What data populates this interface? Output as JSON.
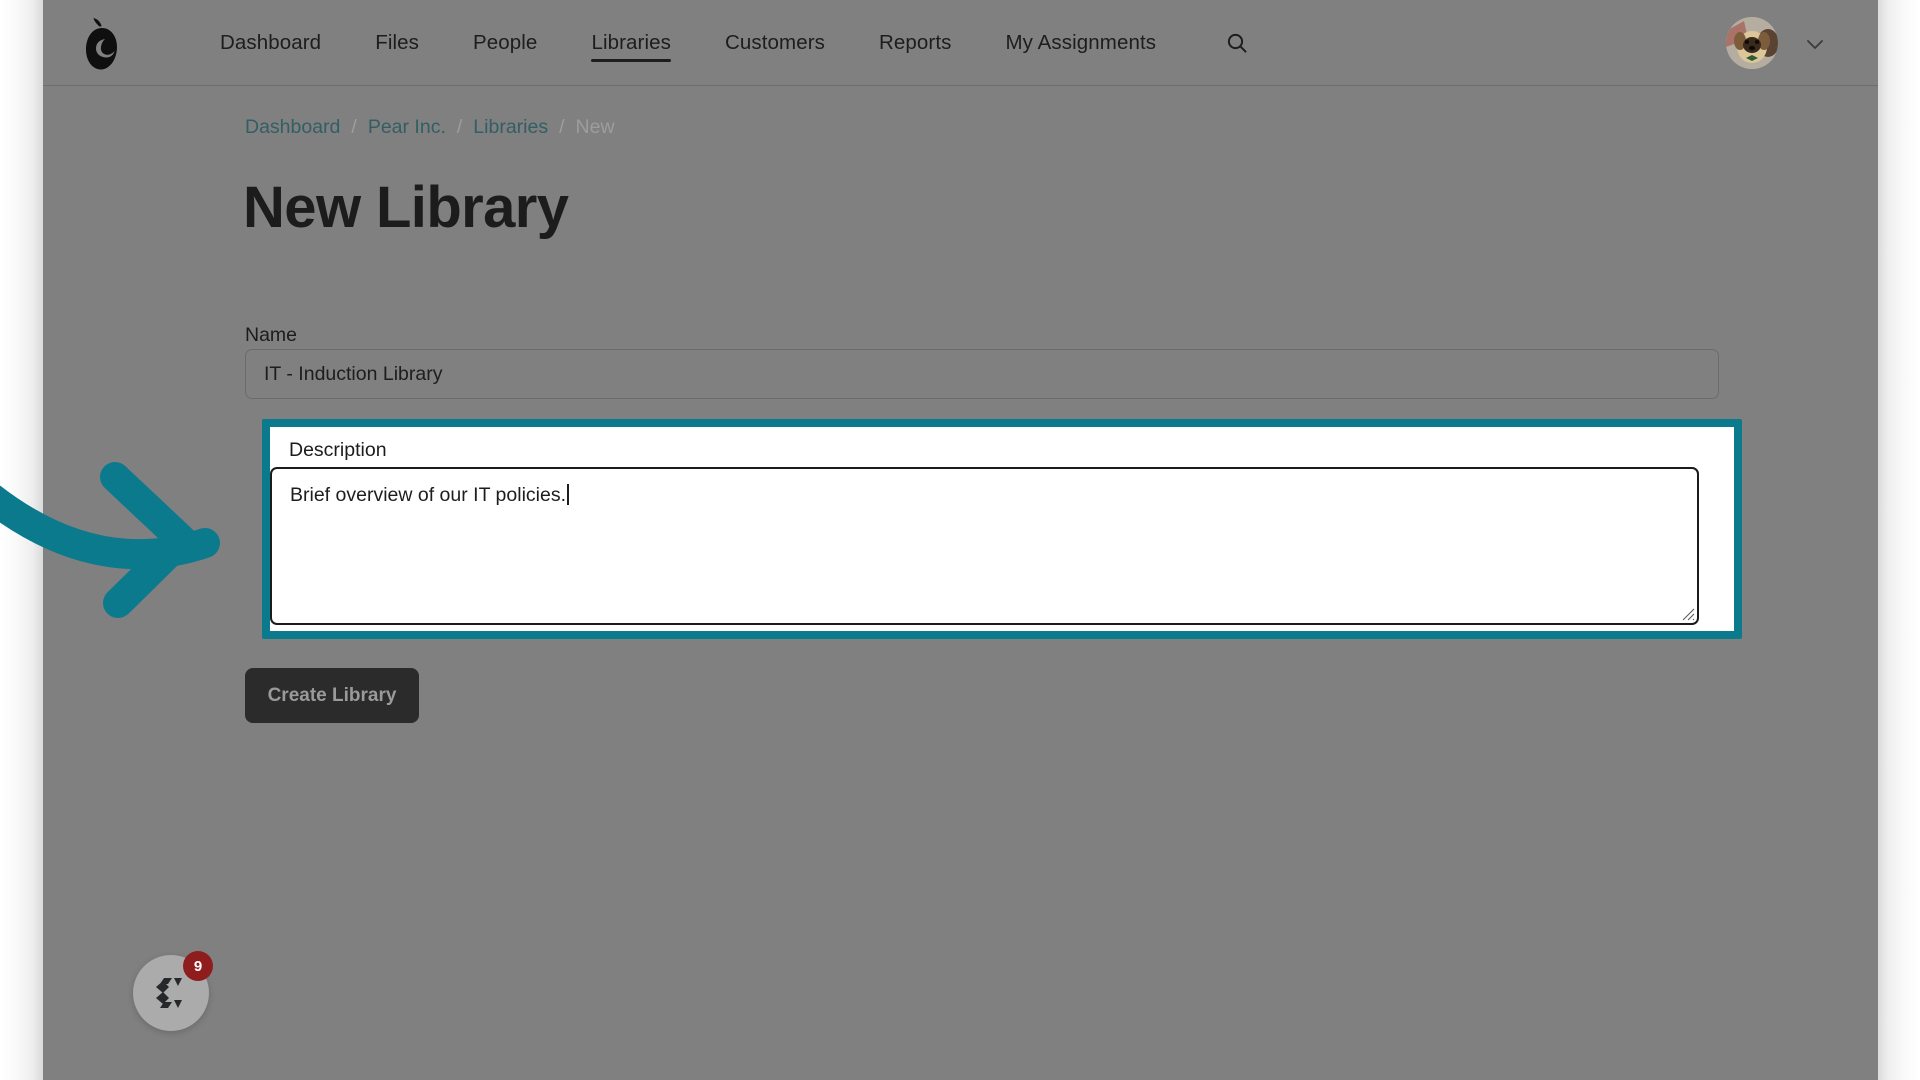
{
  "app": {
    "logo_icon": "pear-logo-icon",
    "accent_color": "#0b7a8c",
    "page_bg": "#808080"
  },
  "nav": {
    "items": [
      {
        "label": "Dashboard",
        "active": false
      },
      {
        "label": "Files",
        "active": false
      },
      {
        "label": "People",
        "active": false
      },
      {
        "label": "Libraries",
        "active": true
      },
      {
        "label": "Customers",
        "active": false
      },
      {
        "label": "Reports",
        "active": false
      },
      {
        "label": "My Assignments",
        "active": false
      }
    ],
    "search_icon": "search-icon",
    "avatar_icon": "user-avatar-dog-photo",
    "chevron_icon": "chevron-down-icon"
  },
  "breadcrumb": {
    "items": [
      {
        "label": "Dashboard",
        "current": false
      },
      {
        "label": "Pear Inc.",
        "current": false
      },
      {
        "label": "Libraries",
        "current": false
      },
      {
        "label": "New",
        "current": true
      }
    ],
    "separator": "/"
  },
  "header": {
    "title": "New Library"
  },
  "form": {
    "name": {
      "label": "Name",
      "value": "IT - Induction Library",
      "placeholder": ""
    },
    "description": {
      "label": "Description",
      "value": "Brief overview of our IT policies.",
      "placeholder": "",
      "highlighted": true,
      "focused": true
    },
    "submit_label": "Create Library"
  },
  "help_widget": {
    "icon": "chat-help-icon",
    "badge_count": "9"
  }
}
